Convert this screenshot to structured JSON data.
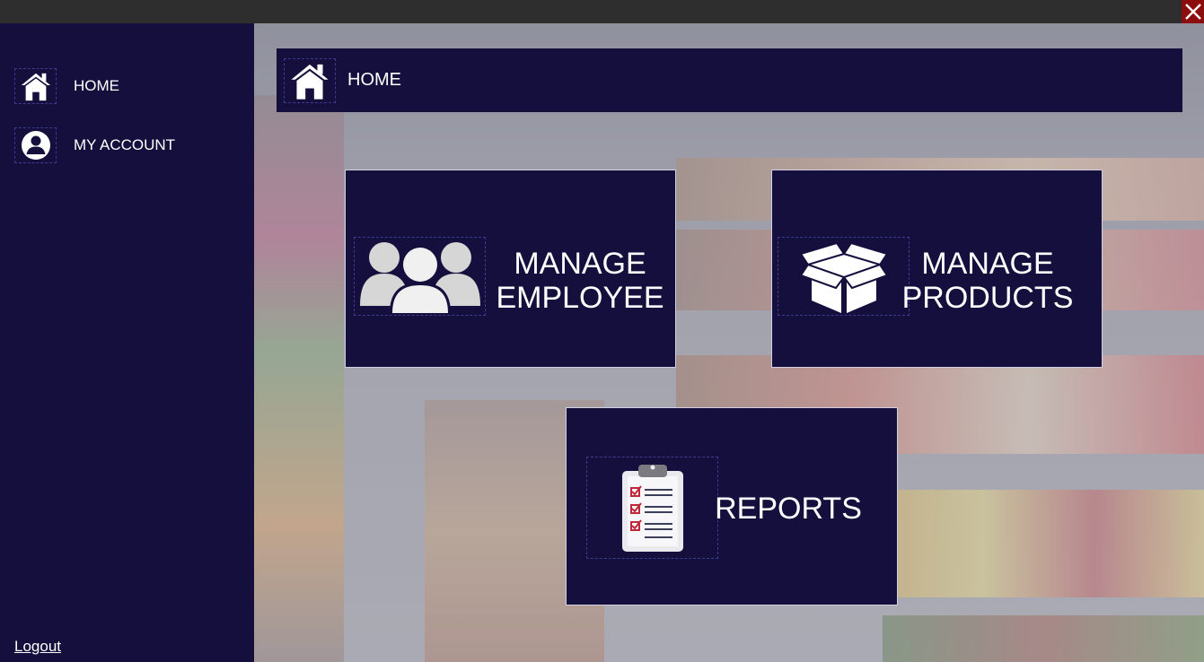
{
  "window": {
    "close_icon": "close-icon"
  },
  "sidebar": {
    "items": [
      {
        "label": "HOME",
        "icon": "home-icon"
      },
      {
        "label": "MY ACCOUNT",
        "icon": "user-circle-icon"
      }
    ],
    "logout": "Logout"
  },
  "header": {
    "title": "HOME",
    "icon": "home-icon"
  },
  "tiles": [
    {
      "label_line1": "MANAGE",
      "label_line2": "EMPLOYEE",
      "icon": "users-icon"
    },
    {
      "label_line1": "MANAGE",
      "label_line2": "PRODUCTS",
      "icon": "box-icon"
    },
    {
      "label": "REPORTS",
      "icon": "clipboard-checklist-icon"
    }
  ],
  "colors": {
    "sidebar_bg": "#150f3e",
    "tile_bg": "#150f3e",
    "titlebar_bg": "#2e2e2e",
    "close_bg": "#8b0d0d",
    "checkmark": "#c0283a"
  }
}
